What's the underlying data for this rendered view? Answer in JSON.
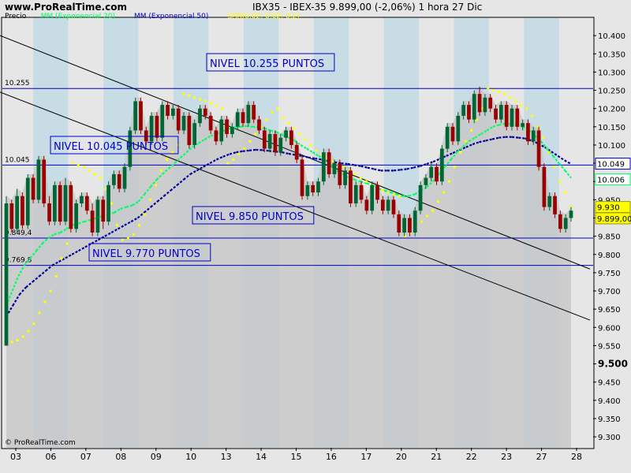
{
  "header": {
    "site": "www.ProRealTime.com",
    "title": "IBX35 - IBEX-35     9.899,00 (-2,06%)     1 hora  27 Dic"
  },
  "legend": [
    {
      "label": "Precio",
      "color": "#000000"
    },
    {
      "label": "MM (Exponencial 20)",
      "color": "#00ff66"
    },
    {
      "label": "MM (Exponencial 50)",
      "color": "#0000cc"
    },
    {
      "label": "SAR(0,02; 0,02; 0,2)",
      "color": "#ffff00"
    }
  ],
  "copyright": "© ProRealTime.com",
  "colors": {
    "up": "#006633",
    "down": "#990000",
    "ema20": "#00ff66",
    "ema50": "#000099",
    "sar": "#ffff00",
    "level": "#0000cc",
    "trend": "#000000",
    "band_light": "#e6e6e6",
    "band_blue": "#c8dce6",
    "grey_fill": "#c8c8c8"
  },
  "chart_data": {
    "type": "candlestick",
    "title": "IBX35 - IBEX-35     9.899,00 (-2,06%)     1 hora  27 Dic",
    "ylim": [
      9270,
      10450
    ],
    "y_ticks": [
      "9.300",
      "9.350",
      "9.400",
      "9.450",
      "9.500",
      "9.550",
      "9.600",
      "9.650",
      "9.700",
      "9.750",
      "9.800",
      "9.850",
      "9.900",
      "9.950",
      "10.000",
      "10.050",
      "10.100",
      "10.150",
      "10.200",
      "10.250",
      "10.300",
      "10.350",
      "10.400"
    ],
    "y_ticks_values": [
      9300,
      9350,
      9400,
      9450,
      9500,
      9550,
      9600,
      9650,
      9700,
      9750,
      9800,
      9850,
      9900,
      9950,
      10000,
      10050,
      10100,
      10150,
      10200,
      10250,
      10300,
      10350,
      10400
    ],
    "y_bold_tick": "9.500",
    "x_ticks": [
      "03",
      "06",
      "07",
      "08",
      "09",
      "10",
      "13",
      "14",
      "15",
      "16",
      "17",
      "20",
      "21",
      "22",
      "23",
      "27",
      "28"
    ],
    "grid": false,
    "levels": [
      {
        "value": 10255,
        "left_label": "10.255",
        "box_label": "NIVEL 10.255 PUNTOS"
      },
      {
        "value": 10045,
        "left_label": "10.045",
        "box_label": "NIVEL 10.045 PUNTOS"
      },
      {
        "value": 9845,
        "left_label": "9.849,4",
        "box_label": "NIVEL 9.850 PUNTOS"
      },
      {
        "value": 9770,
        "left_label": "9.769,8",
        "box_label": "NIVEL 9.770 PUNTOS"
      }
    ],
    "right_labels": [
      {
        "value": 10049,
        "text": "10.049",
        "color": "#0000cc"
      },
      {
        "value": 10006,
        "text": "10.006",
        "color": "#00ff66"
      },
      {
        "value": 9930,
        "text": "9.930",
        "color": "#ffff00"
      },
      {
        "value": 9899,
        "text": "9.899,00",
        "color": "#ffff00"
      }
    ],
    "candles": [
      [
        9550,
        9940,
        9550,
        9960
      ],
      [
        9940,
        9870,
        9860,
        9950
      ],
      [
        9870,
        9960,
        9860,
        9980
      ],
      [
        9960,
        9880,
        9870,
        9970
      ],
      [
        9880,
        10010,
        9870,
        10020
      ],
      [
        10010,
        9950,
        9940,
        10020
      ],
      [
        9950,
        10060,
        9940,
        10070
      ],
      [
        10060,
        9940,
        9930,
        10070
      ],
      [
        9940,
        9890,
        9880,
        9960
      ],
      [
        9890,
        9990,
        9880,
        10000
      ],
      [
        9990,
        9890,
        9880,
        10000
      ],
      [
        9890,
        9990,
        9880,
        10010
      ],
      [
        9990,
        9870,
        9860,
        10000
      ],
      [
        9870,
        9940,
        9860,
        9950
      ],
      [
        9940,
        9960,
        9930,
        9970
      ],
      [
        9960,
        9920,
        9910,
        9970
      ],
      [
        9920,
        9860,
        9850,
        9940
      ],
      [
        9860,
        9950,
        9850,
        9960
      ],
      [
        9950,
        9890,
        9870,
        9960
      ],
      [
        9890,
        9990,
        9880,
        10000
      ],
      [
        9990,
        10020,
        9980,
        10030
      ],
      [
        10020,
        9980,
        9970,
        10030
      ],
      [
        9980,
        10040,
        9970,
        10050
      ],
      [
        10040,
        10140,
        10030,
        10150
      ],
      [
        10140,
        10220,
        10130,
        10230
      ],
      [
        10220,
        10140,
        10130,
        10230
      ],
      [
        10140,
        10110,
        10100,
        10150
      ],
      [
        10110,
        10180,
        10100,
        10190
      ],
      [
        10180,
        10120,
        10110,
        10190
      ],
      [
        10120,
        10210,
        10110,
        10220
      ],
      [
        10210,
        10180,
        10170,
        10220
      ],
      [
        10180,
        10200,
        10170,
        10210
      ],
      [
        10200,
        10140,
        10130,
        10210
      ],
      [
        10140,
        10180,
        10130,
        10190
      ],
      [
        10180,
        10100,
        10090,
        10190
      ],
      [
        10100,
        10160,
        10090,
        10170
      ],
      [
        10160,
        10200,
        10150,
        10210
      ],
      [
        10200,
        10180,
        10170,
        10210
      ],
      [
        10180,
        10140,
        10130,
        10190
      ],
      [
        10140,
        10110,
        10100,
        10150
      ],
      [
        10110,
        10170,
        10100,
        10180
      ],
      [
        10170,
        10130,
        10120,
        10180
      ],
      [
        10130,
        10150,
        10120,
        10160
      ],
      [
        10150,
        10190,
        10140,
        10200
      ],
      [
        10190,
        10160,
        10150,
        10200
      ],
      [
        10160,
        10210,
        10150,
        10220
      ],
      [
        10210,
        10170,
        10160,
        10220
      ],
      [
        10170,
        10140,
        10130,
        10180
      ],
      [
        10140,
        10090,
        10080,
        10150
      ],
      [
        10090,
        10130,
        10080,
        10140
      ],
      [
        10130,
        10080,
        10070,
        10140
      ],
      [
        10080,
        10120,
        10070,
        10130
      ],
      [
        10120,
        10140,
        10110,
        10150
      ],
      [
        10140,
        10100,
        10090,
        10150
      ],
      [
        10100,
        10060,
        10050,
        10110
      ],
      [
        10060,
        9960,
        9950,
        10070
      ],
      [
        9960,
        9990,
        9950,
        10000
      ],
      [
        9990,
        9970,
        9960,
        10000
      ],
      [
        9970,
        10000,
        9960,
        10010
      ],
      [
        10000,
        10080,
        9990,
        10090
      ],
      [
        10080,
        10020,
        10010,
        10090
      ],
      [
        10020,
        10050,
        10010,
        10060
      ],
      [
        10050,
        9990,
        9980,
        10060
      ],
      [
        9990,
        10030,
        9980,
        10040
      ],
      [
        10030,
        9940,
        9930,
        10040
      ],
      [
        9940,
        9990,
        9930,
        10000
      ],
      [
        9990,
        9950,
        9940,
        10000
      ],
      [
        9950,
        9920,
        9910,
        9960
      ],
      [
        9920,
        9990,
        9910,
        10000
      ],
      [
        9990,
        9950,
        9940,
        10000
      ],
      [
        9950,
        9920,
        9910,
        9960
      ],
      [
        9920,
        9950,
        9910,
        9960
      ],
      [
        9950,
        9910,
        9900,
        9960
      ],
      [
        9910,
        9860,
        9850,
        9920
      ],
      [
        9860,
        9900,
        9850,
        9910
      ],
      [
        9900,
        9860,
        9850,
        9910
      ],
      [
        9860,
        9920,
        9850,
        9930
      ],
      [
        9920,
        9990,
        9910,
        10000
      ],
      [
        9990,
        10010,
        9980,
        10020
      ],
      [
        10010,
        10040,
        10000,
        10050
      ],
      [
        10040,
        10000,
        9990,
        10050
      ],
      [
        10000,
        10090,
        9990,
        10100
      ],
      [
        10090,
        10150,
        10080,
        10160
      ],
      [
        10150,
        10110,
        10100,
        10160
      ],
      [
        10110,
        10180,
        10100,
        10190
      ],
      [
        10180,
        10210,
        10170,
        10220
      ],
      [
        10210,
        10170,
        10160,
        10220
      ],
      [
        10170,
        10240,
        10160,
        10250
      ],
      [
        10240,
        10190,
        10180,
        10260
      ],
      [
        10190,
        10230,
        10180,
        10240
      ],
      [
        10230,
        10200,
        10190,
        10240
      ],
      [
        10200,
        10170,
        10160,
        10210
      ],
      [
        10170,
        10210,
        10160,
        10220
      ],
      [
        10210,
        10150,
        10140,
        10220
      ],
      [
        10150,
        10200,
        10140,
        10210
      ],
      [
        10200,
        10150,
        10140,
        10210
      ],
      [
        10150,
        10160,
        10140,
        10170
      ],
      [
        10160,
        10110,
        10100,
        10170
      ],
      [
        10110,
        10140,
        10100,
        10150
      ],
      [
        10140,
        10040,
        10030,
        10150
      ],
      [
        10040,
        9930,
        9920,
        10050
      ],
      [
        9930,
        9960,
        9920,
        9970
      ],
      [
        9960,
        9910,
        9900,
        9970
      ],
      [
        9910,
        9870,
        9860,
        9920
      ],
      [
        9870,
        9900,
        9860,
        9910
      ],
      [
        9900,
        9920,
        9890,
        9930
      ]
    ],
    "ema20": [
      9660,
      9700,
      9740,
      9770,
      9790,
      9810,
      9830,
      9845,
      9855,
      9860,
      9870,
      9880,
      9885,
      9890,
      9895,
      9900,
      9905,
      9910,
      9915,
      9925,
      9930,
      9935,
      9945,
      9965,
      9985,
      10005,
      10020,
      10035,
      10050,
      10065,
      10080,
      10095,
      10105,
      10115,
      10125,
      10130,
      10138,
      10145,
      10148,
      10150,
      10152,
      10150,
      10148,
      10146,
      10140,
      10135,
      10128,
      10120,
      10112,
      10100,
      10090,
      10080,
      10070,
      10060,
      10045,
      10030,
      10020,
      10010,
      10005,
      10000,
      9995,
      9990,
      9980,
      9975,
      9970,
      9965,
      9960,
      9960,
      9965,
      9975,
      9985,
      10000,
      10020,
      10040,
      10060,
      10080,
      10095,
      10110,
      10120,
      10130,
      10140,
      10150,
      10155,
      10158,
      10158,
      10155,
      10150,
      10140,
      10125,
      10110,
      10090,
      10070,
      10050,
      10030,
      10010
    ],
    "ema50": [
      9630,
      9660,
      9690,
      9710,
      9725,
      9740,
      9755,
      9770,
      9780,
      9790,
      9800,
      9810,
      9820,
      9830,
      9840,
      9850,
      9860,
      9870,
      9880,
      9890,
      9900,
      9915,
      9930,
      9945,
      9960,
      9975,
      9990,
      10005,
      10020,
      10030,
      10040,
      10050,
      10060,
      10068,
      10075,
      10080,
      10083,
      10085,
      10087,
      10086,
      10084,
      10082,
      10080,
      10076,
      10073,
      10070,
      10066,
      10063,
      10060,
      10056,
      10053,
      10050,
      10048,
      10045,
      10042,
      10038,
      10034,
      10030,
      10030,
      10030,
      10032,
      10034,
      10038,
      10042,
      10048,
      10054,
      10062,
      10070,
      10078,
      10086,
      10094,
      10102,
      10108,
      10112,
      10116,
      10120,
      10122,
      10122,
      10120,
      10118,
      10112,
      10104,
      10094,
      10082,
      10070,
      10058,
      10048
    ],
    "sar": [
      9555,
      9560,
      9565,
      9575,
      9590,
      9610,
      9640,
      9670,
      9700,
      9740,
      9790,
      9830,
      10050,
      10045,
      10040,
      10030,
      10020,
      10010,
      9980,
      9940,
      9880,
      9840,
      9845,
      9855,
      9880,
      9910,
      9950,
      9990,
      10030,
      10060,
      10080,
      10100,
      10240,
      10235,
      10230,
      10225,
      10220,
      10215,
      10208,
      10200,
      10050,
      10060,
      10075,
      10090,
      10110,
      10130,
      10150,
      10170,
      10190,
      10200,
      10175,
      10160,
      10145,
      10130,
      10115,
      10100,
      10085,
      10075,
      10065,
      10055,
      10045,
      10040,
      10030,
      10020,
      10010,
      10000,
      9990,
      9980,
      9975,
      9970,
      9965,
      9960,
      9850,
      9860,
      9875,
      9890,
      9905,
      9920,
      9945,
      9970,
      10000,
      10040,
      10080,
      10110,
      10140,
      10170,
      10200,
      10255,
      10250,
      10245,
      10240,
      10230,
      10220,
      10210,
      10200,
      10180,
      10150,
      10120,
      10080,
      10040,
      10000,
      9970,
      9930
    ],
    "trend_lines": [
      {
        "x0": 0,
        "y0": 10400,
        "x1": 748,
        "y1": 9760
      },
      {
        "x0": 0,
        "y0": 10245,
        "x1": 748,
        "y1": 9620
      }
    ]
  }
}
